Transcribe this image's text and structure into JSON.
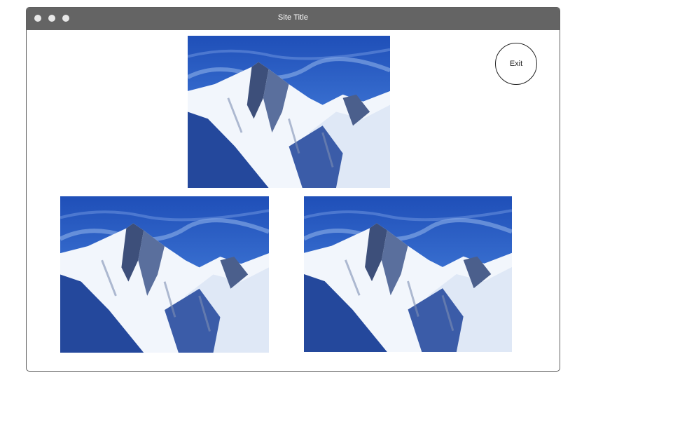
{
  "window": {
    "title": "Site Title"
  },
  "actions": {
    "exit_label": "Exit"
  },
  "gallery": {
    "images": [
      {
        "subject": "snowy-mountain-photo"
      },
      {
        "subject": "snowy-mountain-photo"
      },
      {
        "subject": "snowy-mountain-photo"
      }
    ]
  },
  "colors": {
    "titlebar": "#646464",
    "window_dots": "#e8e8e8",
    "sky": "#2a5bbf",
    "snow": "#f2f6fc",
    "rock": "#3d4f7a"
  }
}
